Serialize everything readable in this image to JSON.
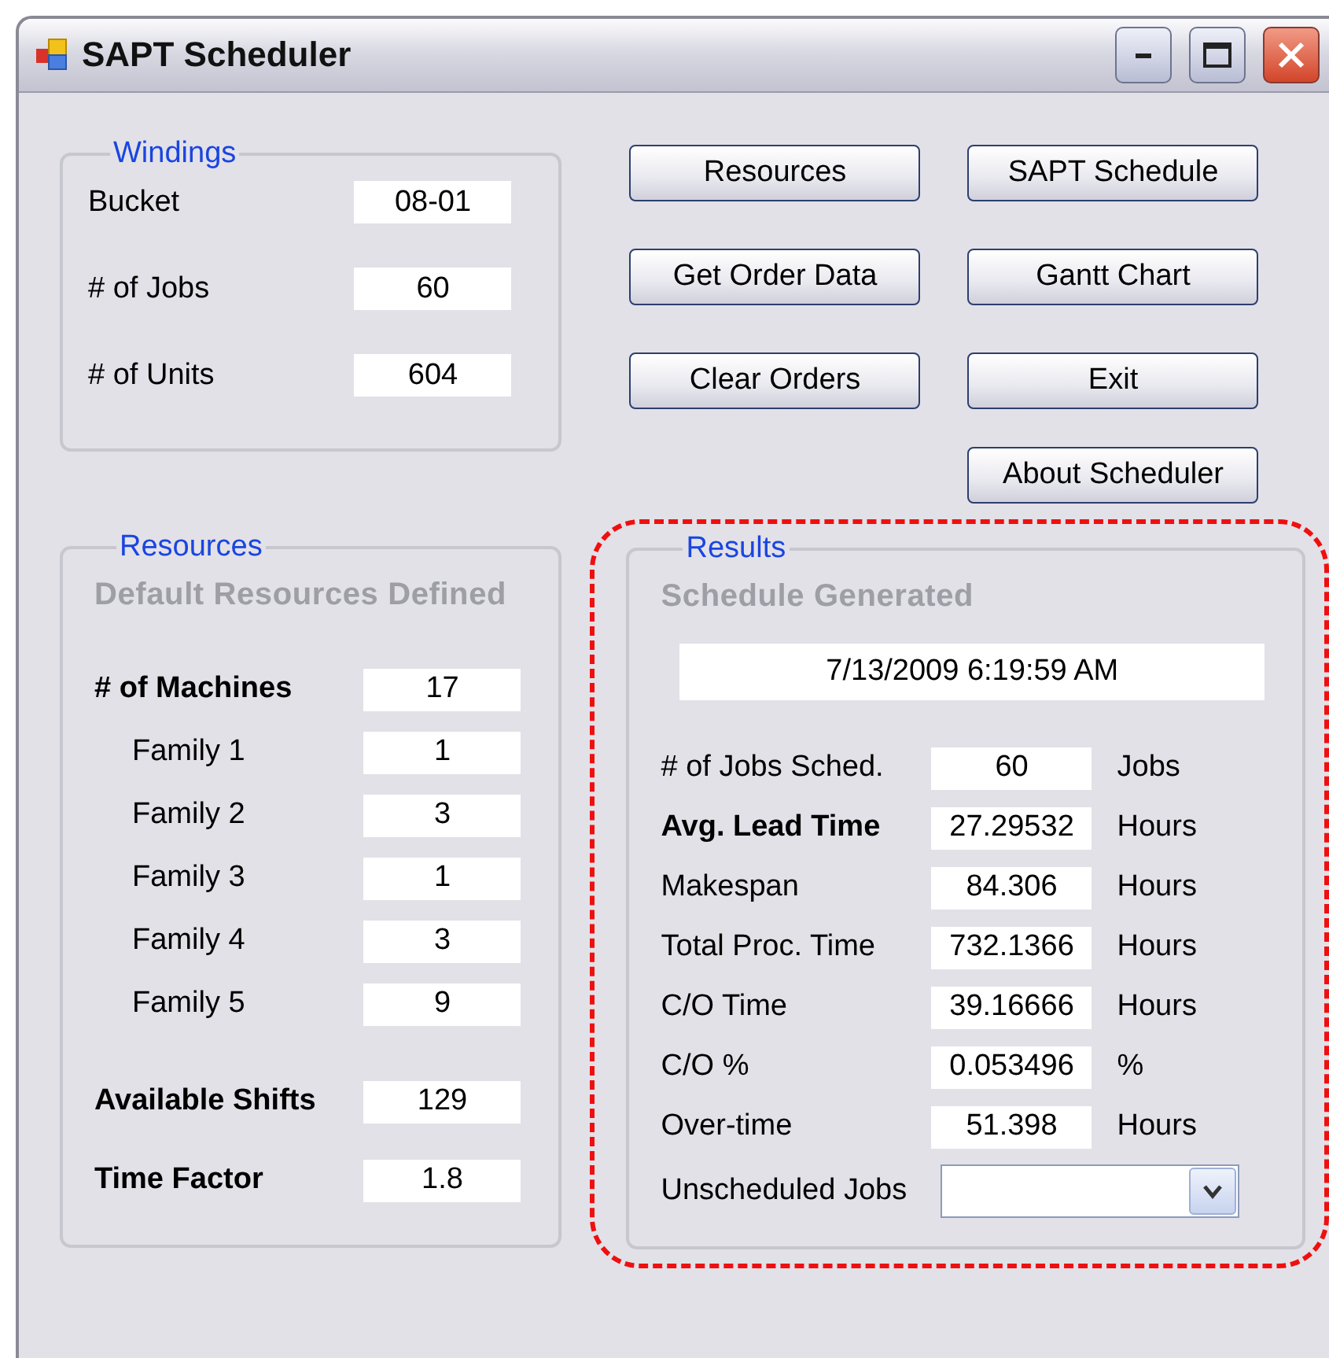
{
  "window": {
    "title": "SAPT Scheduler"
  },
  "windings": {
    "title": "Windings",
    "fields": [
      {
        "label": "Bucket",
        "value": "08-01"
      },
      {
        "label": "# of Jobs",
        "value": "60"
      },
      {
        "label": "# of Units",
        "value": "604"
      }
    ]
  },
  "buttons": [
    {
      "label": "Resources"
    },
    {
      "label": "SAPT Schedule"
    },
    {
      "label": "Get Order Data"
    },
    {
      "label": "Gantt Chart"
    },
    {
      "label": "Clear Orders"
    },
    {
      "label": "Exit"
    },
    {
      "label": "About Scheduler"
    }
  ],
  "resources": {
    "title": "Resources",
    "status": "Default Resources Defined",
    "rows": [
      {
        "kind": "main",
        "label": "# of Machines",
        "value": "17"
      },
      {
        "kind": "sub",
        "label": "Family 1",
        "value": "1"
      },
      {
        "kind": "sub",
        "label": "Family 2",
        "value": "3"
      },
      {
        "kind": "sub",
        "label": "Family 3",
        "value": "1"
      },
      {
        "kind": "sub",
        "label": "Family 4",
        "value": "3"
      },
      {
        "kind": "sub",
        "label": "Family 5",
        "value": "9"
      },
      {
        "kind": "main",
        "label": "Available Shifts",
        "value": "129"
      },
      {
        "kind": "main",
        "label": "Time Factor",
        "value": "1.8"
      }
    ]
  },
  "results": {
    "title": "Results",
    "status": "Schedule Generated",
    "timestamp": "7/13/2009 6:19:59 AM",
    "rows": [
      {
        "label": "# of Jobs Sched.",
        "bold": false,
        "value": "60",
        "unit": "Jobs"
      },
      {
        "label": "Avg. Lead Time",
        "bold": true,
        "value": "27.29532",
        "unit": "Hours"
      },
      {
        "label": "Makespan",
        "bold": false,
        "value": "84.306",
        "unit": "Hours"
      },
      {
        "label": "Total Proc. Time",
        "bold": false,
        "value": "732.1366",
        "unit": "Hours"
      },
      {
        "label": "C/O Time",
        "bold": false,
        "value": "39.16666",
        "unit": "Hours"
      },
      {
        "label": "C/O %",
        "bold": false,
        "value": "0.053496",
        "unit": "%"
      },
      {
        "label": "Over-time",
        "bold": false,
        "value": "51.398",
        "unit": "Hours"
      }
    ],
    "combo": {
      "label": "Unscheduled Jobs"
    }
  }
}
